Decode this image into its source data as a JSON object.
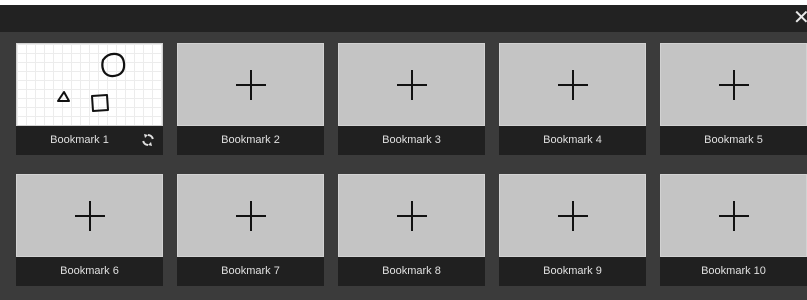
{
  "window": {
    "close_icon": "close-icon"
  },
  "bookmarks": [
    {
      "label": "Bookmark 1",
      "has_drawing": true,
      "refresh_icon": "refresh-icon"
    },
    {
      "label": "Bookmark 2"
    },
    {
      "label": "Bookmark 3"
    },
    {
      "label": "Bookmark 4"
    },
    {
      "label": "Bookmark 5"
    },
    {
      "label": "Bookmark 6"
    },
    {
      "label": "Bookmark 7"
    },
    {
      "label": "Bookmark 8"
    },
    {
      "label": "Bookmark 9"
    },
    {
      "label": "Bookmark 10"
    }
  ],
  "empty_slot_icon": "plus-icon",
  "colors": {
    "background": "#3b3b3b",
    "titlebar": "#222222",
    "label_bar": "#202020",
    "empty_thumb": "#c4c4c4"
  }
}
